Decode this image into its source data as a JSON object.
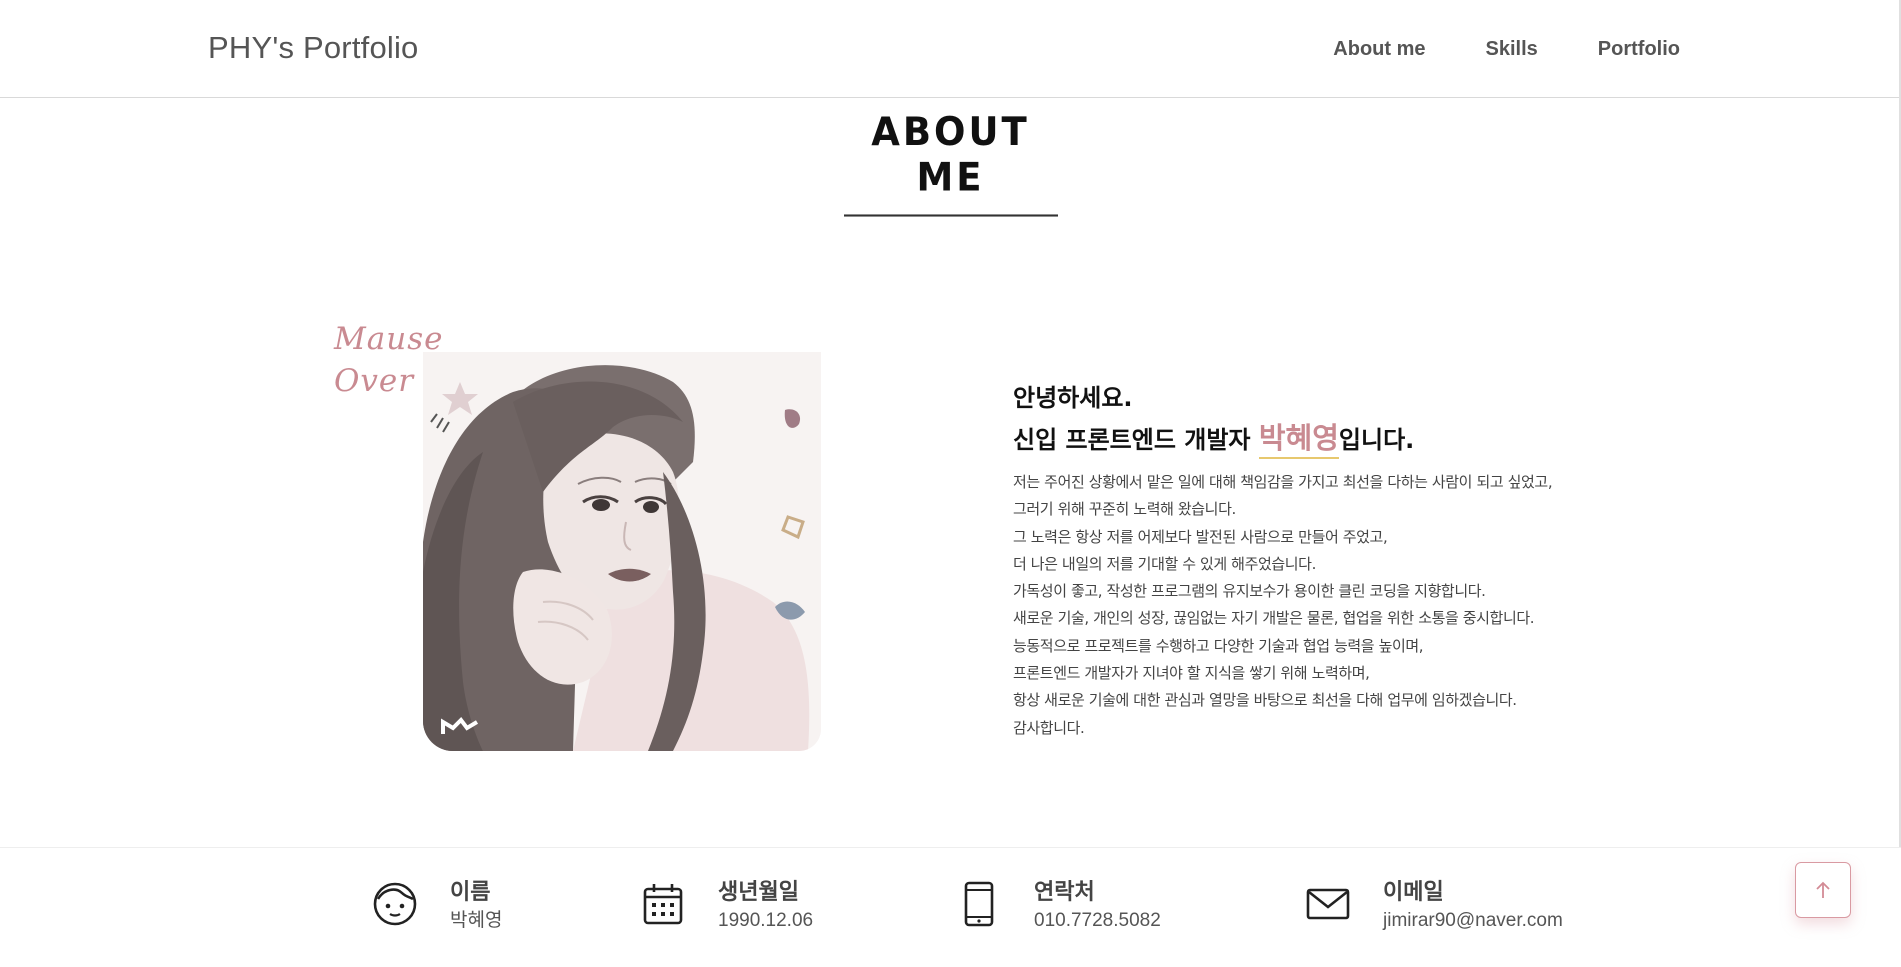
{
  "header": {
    "logo": "PHY's Portfolio",
    "nav": [
      "About me",
      "Skills",
      "Portfolio"
    ]
  },
  "section": {
    "title": "ABOUT ME"
  },
  "portrait": {
    "hover_hint": [
      "Mause",
      "Over"
    ]
  },
  "intro": {
    "greeting_line1": "안녕하세요.",
    "greeting_prefix": "신입 프론트엔드 개발자 ",
    "name": "박혜영",
    "greeting_suffix": "입니다.",
    "body": [
      "저는 주어진 상황에서 맡은 일에 대해 책임감을 가지고 최선을 다하는 사람이 되고 싶었고,",
      "그러기 위해 꾸준히 노력해 왔습니다.",
      "그 노력은 항상 저를 어제보다 발전된 사람으로 만들어 주었고,",
      "더 나은 내일의 저를 기대할 수 있게 해주었습니다.",
      "가독성이 좋고, 작성한 프로그램의 유지보수가 용이한 클린 코딩을 지향합니다.",
      "새로운 기술, 개인의 성장, 끊임없는 자기 개발은 물론, 협업을 위한 소통을 중시합니다.",
      "능동적으로 프로젝트를 수행하고 다양한 기술과 협업 능력을 높이며,",
      "프론트엔드 개발자가 지녀야 할 지식을 쌓기 위해 노력하며,",
      "항상 새로운 기술에 대한 관심과 열망을 바탕으로 최선을 다해 업무에 임하겠습니다.",
      "감사합니다."
    ]
  },
  "info": [
    {
      "icon": "face-icon",
      "label": "이름",
      "value": "박혜영"
    },
    {
      "icon": "calendar-icon",
      "label": "생년월일",
      "value": "1990.12.06"
    },
    {
      "icon": "phone-icon",
      "label": "연락처",
      "value": "010.7728.5082"
    },
    {
      "icon": "mail-icon",
      "label": "이메일",
      "value": "jimirar90@naver.com"
    }
  ],
  "colors": {
    "accent": "#c98a91",
    "underline": "#e7c86e",
    "border": "#d9d9d9"
  },
  "scroll_top": {
    "icon": "arrow-up-icon"
  }
}
